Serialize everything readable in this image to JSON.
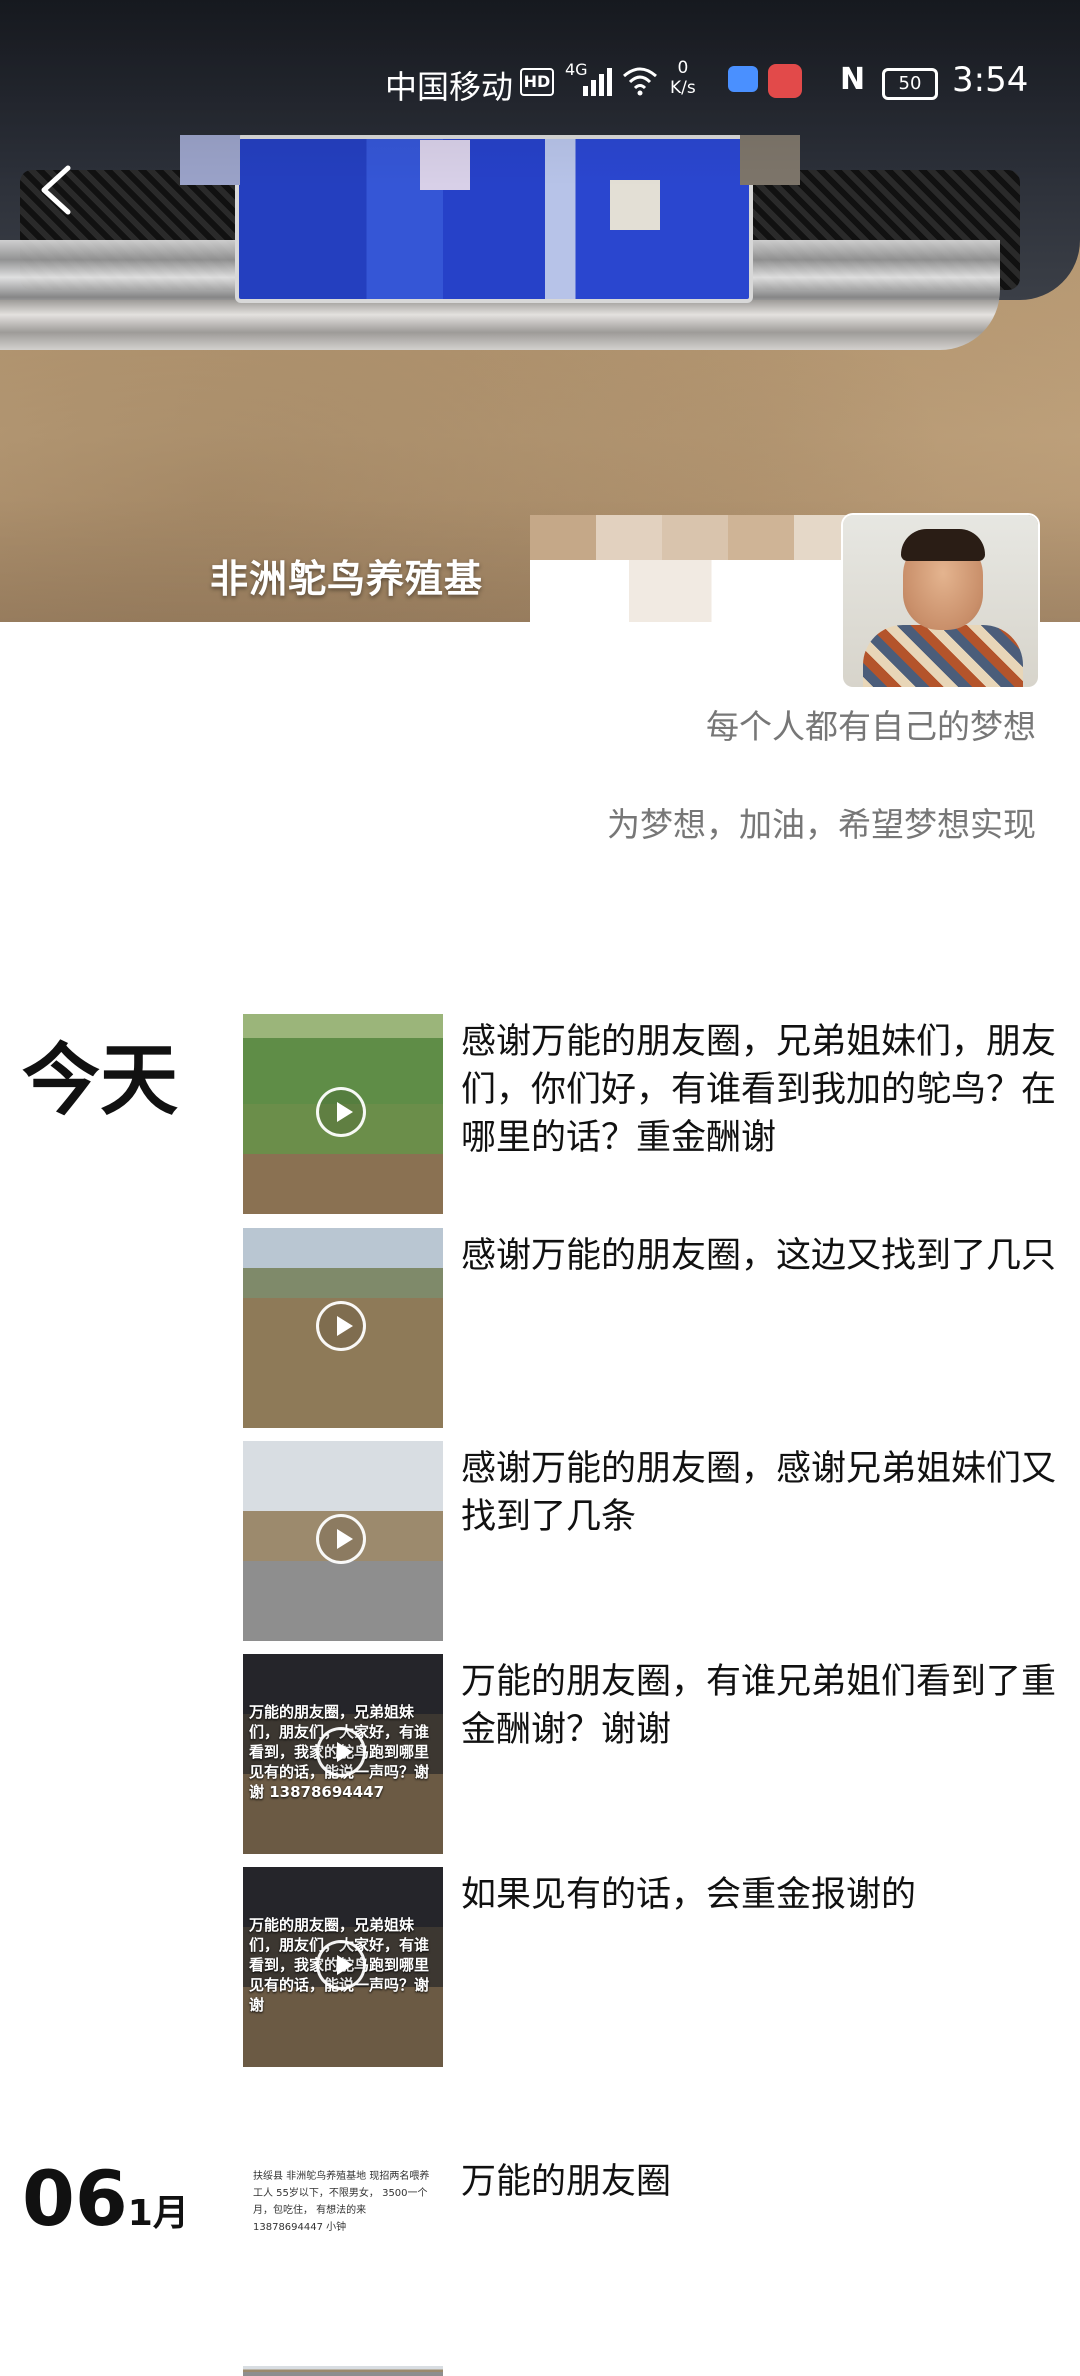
{
  "status_bar": {
    "carrier": "中国移动",
    "hd": "HD",
    "network": "4G",
    "speed_value": "0",
    "speed_unit": "K/s",
    "battery": "50",
    "time": "3:54"
  },
  "cover": {
    "title": "非洲鸵鸟养殖基"
  },
  "profile": {
    "signature_line1": "每个人都有自己的梦想",
    "signature_line2": "为梦想，加油，希望梦想实现"
  },
  "timeline": {
    "today_label": "今天",
    "posts_today": [
      {
        "text": "感谢万能的朋友圈，兄弟姐妹们，朋友们，你们好，有谁看到我加的鸵鸟？在哪里的话？重金酬谢"
      },
      {
        "text": "感谢万能的朋友圈，这边又找到了几只"
      },
      {
        "text": "感谢万能的朋友圈，感谢兄弟姐妹们又找到了几条"
      },
      {
        "text": "万能的朋友圈，有谁兄弟姐们看到了重金酬谢？谢谢",
        "thumb_caption": "万能的朋友圈，兄弟姐妹们，朋友们，大家好，有谁看到，我家的鸵鸟跑到哪里见有的话，能说一声吗？谢谢 13878694447"
      },
      {
        "text": "如果见有的话，会重金报谢的",
        "thumb_caption": "万能的朋友圈，兄弟姐妹们，朋友们，大家好，有谁看到，我家的鸵鸟跑到哪里见有的话，能说一声吗？谢谢"
      }
    ],
    "date_day": "06",
    "date_month": "1月",
    "posts_date": [
      {
        "text": "万能的朋友圈",
        "thumb_caption": "扶绥县 非洲鸵鸟养殖基地 现招两名喂养工人 55岁以下，不限男女， 3500一个月，包吃住， 有想法的来 13878694447 小钟"
      }
    ]
  }
}
